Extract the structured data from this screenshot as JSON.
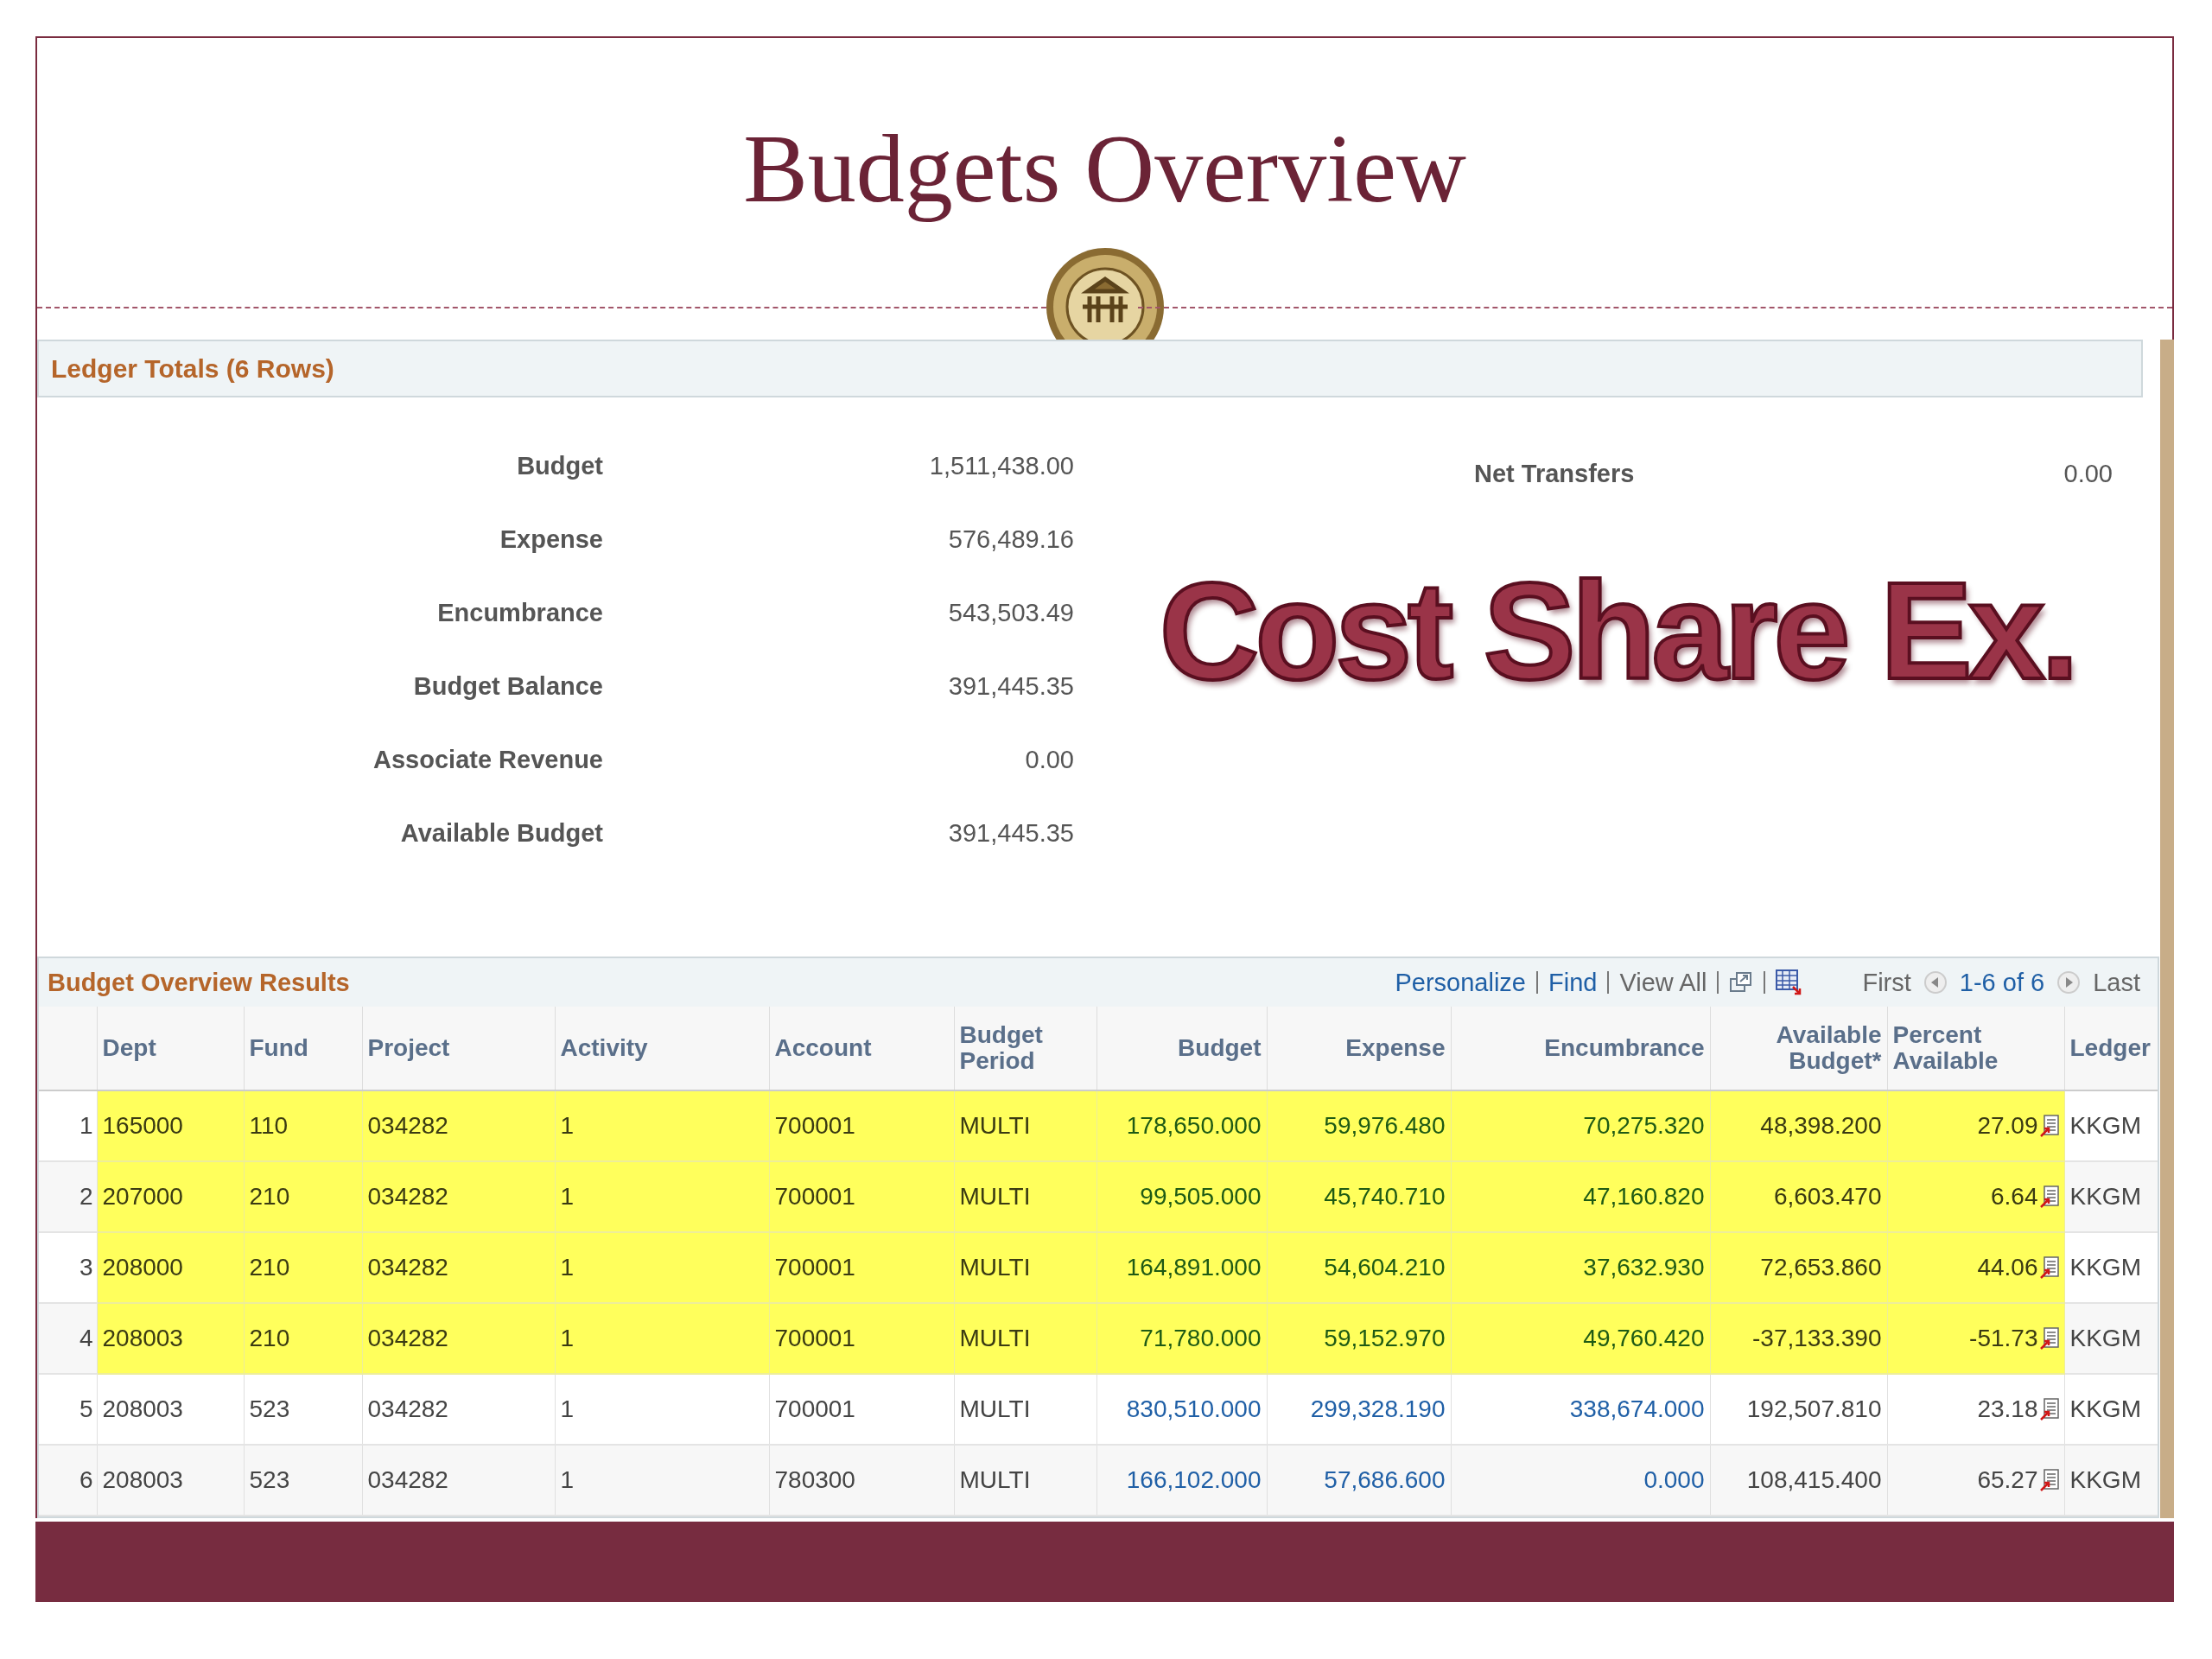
{
  "slide": {
    "title": "Budgets Overview",
    "overlay_text": "Cost Share Ex."
  },
  "ledger_totals": {
    "title": "Ledger Totals (6 Rows)",
    "items": [
      {
        "label": "Budget",
        "value": "1,511,438.00"
      },
      {
        "label": "Expense",
        "value": "576,489.16"
      },
      {
        "label": "Encumbrance",
        "value": "543,503.49"
      },
      {
        "label": "Budget Balance",
        "value": "391,445.35"
      },
      {
        "label": "Associate Revenue",
        "value": "0.00"
      },
      {
        "label": "Available Budget",
        "value": "391,445.35"
      }
    ],
    "side_item": {
      "label": "Net Transfers",
      "value": "0.00"
    }
  },
  "results": {
    "title": "Budget Overview Results",
    "toolbar": [
      {
        "kind": "link",
        "label": "Personalize"
      },
      {
        "kind": "link",
        "label": "Find"
      },
      {
        "kind": "text",
        "label": "View All"
      },
      {
        "kind": "zoom"
      },
      {
        "kind": "download"
      }
    ],
    "pager": {
      "first": "First",
      "range": "1-6 of 6",
      "last": "Last"
    },
    "columns": [
      {
        "label": "Dept",
        "kind": "text"
      },
      {
        "label": "Fund",
        "kind": "text"
      },
      {
        "label": "Project",
        "kind": "text"
      },
      {
        "label": "Activity",
        "kind": "text"
      },
      {
        "label": "Account",
        "kind": "text"
      },
      {
        "label": "Budget Period",
        "kind": "text"
      },
      {
        "label": "Budget",
        "kind": "link"
      },
      {
        "label": "Expense",
        "kind": "link"
      },
      {
        "label": "Encumbrance",
        "kind": "link"
      },
      {
        "label": "Available Budget*",
        "kind": "number"
      },
      {
        "label": "Percent Available",
        "kind": "percent"
      },
      {
        "label": "Ledger",
        "kind": "text"
      }
    ],
    "rows": [
      {
        "number": "1",
        "highlighted": true,
        "cells": [
          "165000",
          "110",
          "034282",
          "1",
          "700001",
          "MULTI",
          "178,650.000",
          "59,976.480",
          "70,275.320",
          "48,398.200",
          "27.09",
          "KKGM"
        ]
      },
      {
        "number": "2",
        "highlighted": true,
        "cells": [
          "207000",
          "210",
          "034282",
          "1",
          "700001",
          "MULTI",
          "99,505.000",
          "45,740.710",
          "47,160.820",
          "6,603.470",
          "6.64",
          "KKGM"
        ]
      },
      {
        "number": "3",
        "highlighted": true,
        "cells": [
          "208000",
          "210",
          "034282",
          "1",
          "700001",
          "MULTI",
          "164,891.000",
          "54,604.210",
          "37,632.930",
          "72,653.860",
          "44.06",
          "KKGM"
        ]
      },
      {
        "number": "4",
        "highlighted": true,
        "cells": [
          "208003",
          "210",
          "034282",
          "1",
          "700001",
          "MULTI",
          "71,780.000",
          "59,152.970",
          "49,760.420",
          "-37,133.390",
          "-51.73",
          "KKGM"
        ]
      },
      {
        "number": "5",
        "highlighted": false,
        "cells": [
          "208003",
          "523",
          "034282",
          "1",
          "700001",
          "MULTI",
          "830,510.000",
          "299,328.190",
          "338,674.000",
          "192,507.810",
          "23.18",
          "KKGM"
        ]
      },
      {
        "number": "6",
        "highlighted": false,
        "cells": [
          "208003",
          "523",
          "034282",
          "1",
          "780300",
          "MULTI",
          "166,102.000",
          "57,686.600",
          "0.000",
          "108,415.400",
          "65.27",
          "KKGM"
        ]
      }
    ]
  }
}
